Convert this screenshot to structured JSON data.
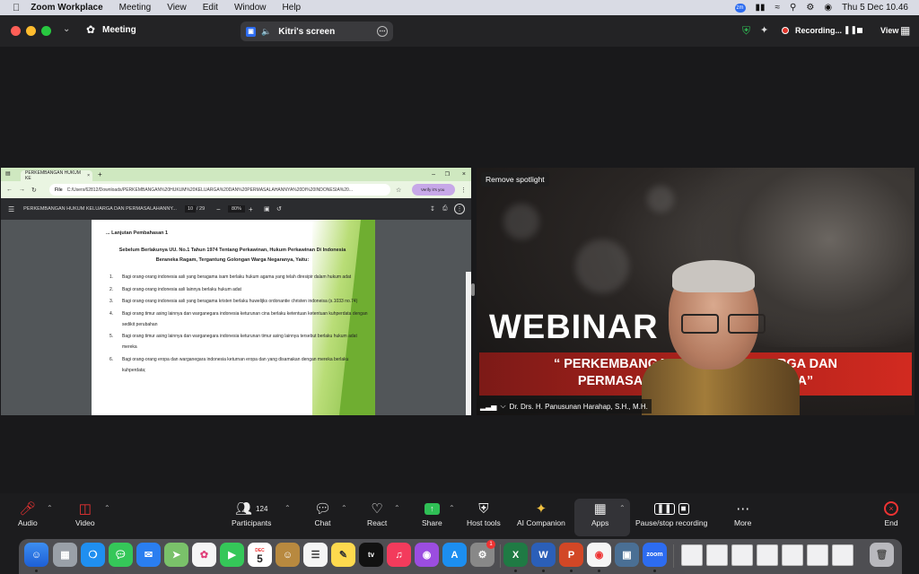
{
  "menubar": {
    "app": "Zoom Workplace",
    "items": [
      "Meeting",
      "View",
      "Edit",
      "Window",
      "Help"
    ],
    "datetime": "Thu 5 Dec  10.46",
    "zm": "zm"
  },
  "titlebar": {
    "title": "Meeting",
    "screen_label": "Kitri's screen",
    "recording": "Recording...",
    "view": "View"
  },
  "browser": {
    "tab_title": "PERKEMBANGAN HUKUM KE",
    "file_label": "File",
    "url": "C:/Users/62812/Downloads/PERKEMBANGAN%20HUKUM%20KELUARGA%20DAN%20PERMASALAHANNYA%20DI%20INDONESIA%20...",
    "verify": "Verify it's you"
  },
  "pdf": {
    "title": "PERKEMBANGAN HUKUM KELUARGA DAN PERMASALAHANNY...",
    "page": "10",
    "of": "/ 29",
    "zoom": "80%",
    "heading": "... Lanjutan Pembahasan 1",
    "subheading": "Sebelum Berlakunya UU. No.1 Tahun 1974 Tentang Perkawinan, Hukum Perkawinan Di Indonesia Beraneka Ragam, Tergantung Golongan Warga Negaranya, Yaitu:",
    "items": [
      {
        "n": "1.",
        "t": "Bagi orang-orang indonesia asli yang beragama isam berlaku hukum agama yang telah diresipir dalam hukum adat"
      },
      {
        "n": "2.",
        "t": "Bagi orang-orang indonesia asli lainnya berlaku hukum  adat"
      },
      {
        "n": "3.",
        "t": "Bagi orang-orang indonesia asli yang beragama kristen berlaku huwelijks ordonantie christen indoneisa (s.1033 no.74)"
      },
      {
        "n": "4.",
        "t": "Bagi orang timur asing lainnya dan warganegara indonesia keturunan  cina berlaku ketentuan ketentuan kuhperdata dengan sedikit perubahan"
      },
      {
        "n": "5.",
        "t": "Bagi orang timur asing lainnya dan warganegara indonesia keturunan timur asing lainnya tersebut berlaku hukum adat mereka"
      },
      {
        "n": "6.",
        "t": "Bagi orang-orang eropa dan warganegara indonesia keturnan eropa dan yang disamakan dengan mereka berlaku kuhperdata;"
      }
    ]
  },
  "video": {
    "remove_spotlight": "Remove spotlight",
    "webinar": "WEBINAR",
    "banner_line1": "“ PERKEMBANGAN HUKUM KELUARGA DAN",
    "banner_line2": "PERMASALAHANNYA DI INDONESIA”",
    "name": "Dr. Drs. H. Panusunan Harahap, S.H., M.H."
  },
  "toolbar": {
    "audio": "Audio",
    "video": "Video",
    "participants": "Participants",
    "participants_count": "124",
    "chat": "Chat",
    "react": "React",
    "share": "Share",
    "host_tools": "Host tools",
    "ai": "AI Companion",
    "apps": "Apps",
    "record": "Pause/stop recording",
    "more": "More",
    "end": "End"
  },
  "dock": {
    "calendar_month": "DEC",
    "calendar_day": "5",
    "tv": "tv",
    "zoom": "zoom",
    "badge": "1"
  }
}
